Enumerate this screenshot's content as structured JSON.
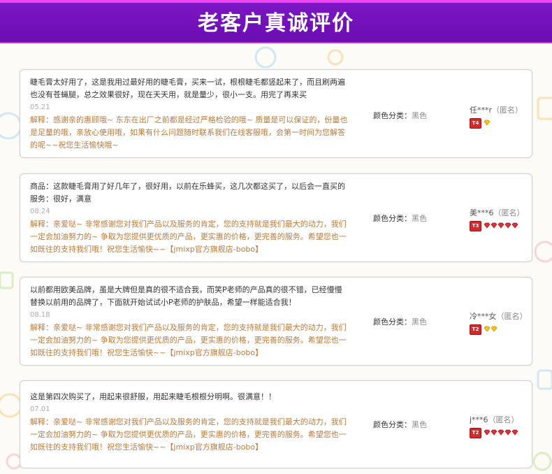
{
  "header": {
    "title": "老客户真诚评价"
  },
  "colors": {
    "header_bg": "#6a0db0",
    "accent": "#ee44ee",
    "reply": "#bc7a3a"
  },
  "reviews": [
    {
      "lines": [
        "睫毛膏太好用了，这是我用过最好用的睫毛膏，买来一试，根根睫毛都竖起来了，而且刷两遍",
        "也没有苍蝇腿，总之效果很好，现在天天用，就是量少，很小一支。用完了再来买"
      ],
      "date": "05.21",
      "reply_lines": [
        "解释：感谢亲的惠顾哦~ 东东在出厂之前都是经过严格检验的哦~ 质量是可以保证的，份量也",
        "是足量的哦，亲放心使用哦，如果有什么问题随时联系我们在线客服哦，会第一时间为您解答",
        "的呢~~祝您生活愉快哦~"
      ],
      "attr_label": "颜色分类：",
      "attr_value": "黑色",
      "user": "任***r",
      "anon": "（匿名）",
      "level": "T4",
      "gem_color": "gold",
      "gems": 1
    },
    {
      "lines": [
        "商品：这款睫毛膏用了好几年了，很好用，以前在乐蜂买，这几次都这买了，以后会一直买的",
        "服务：很好，满意"
      ],
      "date": "08.24",
      "reply_lines": [
        "解释：亲爱哒~ 非常感谢您对我们产品以及服务的肯定，您的支持就是我们最大的动力，我们",
        "一定会加油努力的~ 争取为您提供更优质的产品，更实惠的价格，更完善的服务。希望您也一",
        "如既往的支持我们哦！祝您生活愉快~~【jmixp官方旗舰店-bobo】"
      ],
      "attr_label": "颜色分类：",
      "attr_value": "黑色",
      "user": "美***6",
      "anon": "（匿名）",
      "level": "T3",
      "gem_color": "red",
      "gems": 5
    },
    {
      "lines": [
        "以前都用欧美品牌，虽是大牌但是真的很不适合我，而笑P老师的产品真的很不错，已经慢慢",
        "替换以前用的品牌了，下面就开始试试小P老师的护肤品，希望一样能适合我！"
      ],
      "date": "08.18",
      "reply_lines": [
        "解释：亲爱哒~ 非常感谢您对我们产品以及服务的肯定，您的支持就是我们最大的动力，我们",
        "一定会加油努力的~ 争取为您提供更优质的产品，更实惠的价格，更完善的服务。希望您也一",
        "如既往的支持我们哦！祝您生活愉快~~【jmixp官方旗舰店-bobo】"
      ],
      "attr_label": "颜色分类：",
      "attr_value": "黑色",
      "user": "冷***女",
      "anon": "（匿名）",
      "level": "T2",
      "gem_color": "gold",
      "gems": 2
    },
    {
      "lines": [
        "这是第四次购买了，用起来很舒服，用起来睫毛根根分明啊。很满意！！"
      ],
      "date": "07.01",
      "reply_lines": [
        "解释：亲爱哒~ 非常感谢您对我们产品以及服务的肯定，您的支持就是我们最大的动力，我们",
        "一定会加油努力的~ 争取为您提供更优质的产品，更实惠的价格，更完善的服务。希望您也一",
        "如既往的支持我们哦！祝您生活愉快~~【jmixp官方旗舰店-bobo】"
      ],
      "attr_label": "颜色分类：",
      "attr_value": "黑色",
      "user": "j***6",
      "anon": "（匿名）",
      "level": "T2",
      "gem_color": "red",
      "gems": 5
    }
  ]
}
